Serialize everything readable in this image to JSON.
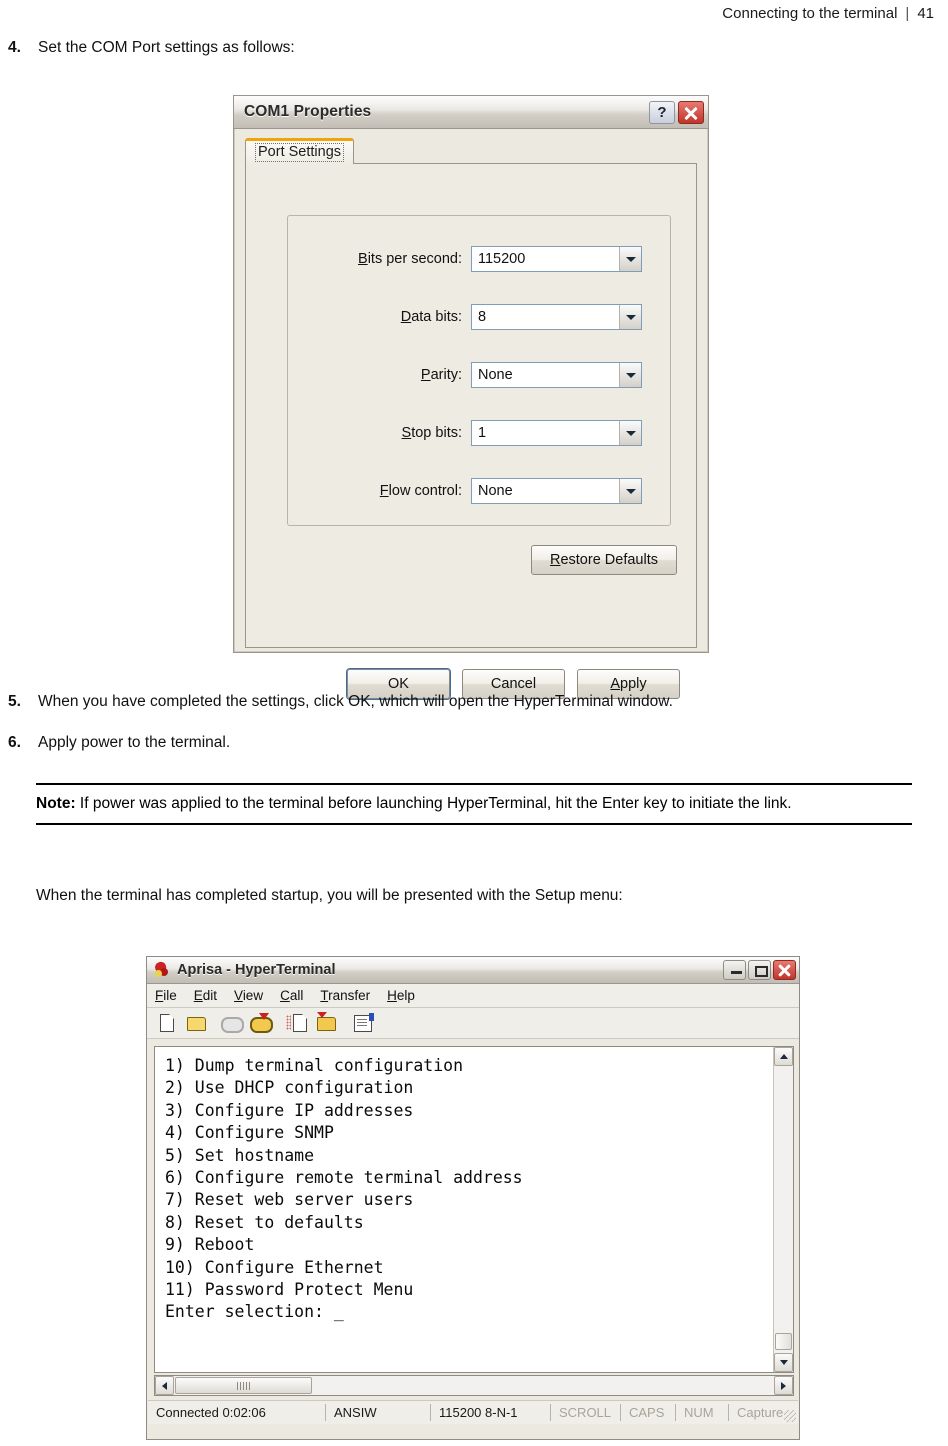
{
  "page_header": {
    "title": "Connecting to the terminal",
    "separator": "|",
    "page_number": "41"
  },
  "steps": [
    {
      "num": "4.",
      "text": "Set the COM Port settings as follows:"
    },
    {
      "num": "5.",
      "text": "When you have completed the settings, click OK, which will open the HyperTerminal window."
    },
    {
      "num": "6.",
      "text": "Apply power to the terminal."
    }
  ],
  "note": {
    "label": "Note:",
    "text": " If power was applied to the terminal before launching HyperTerminal, hit the Enter key to initiate the link."
  },
  "paragraph": "When the terminal has completed startup, you will be presented with the Setup menu:",
  "com_dialog": {
    "title": "COM1 Properties",
    "help_button": "?",
    "tab": "Port Settings",
    "fields": [
      {
        "label_pre": "B",
        "label_rest": "its per second:",
        "value": "115200"
      },
      {
        "label_pre": "D",
        "label_rest": "ata bits:",
        "value": "8"
      },
      {
        "label_pre": "P",
        "label_rest": "arity:",
        "value": "None"
      },
      {
        "label_pre": "S",
        "label_rest": "top bits:",
        "value": "1"
      },
      {
        "label_pre": "F",
        "label_rest": "low control:",
        "value": "None"
      }
    ],
    "restore_pre": "R",
    "restore_rest": "estore Defaults",
    "ok": "OK",
    "cancel": "Cancel",
    "apply_pre": "A",
    "apply_rest": "pply"
  },
  "hyperterminal": {
    "title": "Aprisa - HyperTerminal",
    "menus": [
      {
        "pre": "F",
        "rest": "ile"
      },
      {
        "pre": "E",
        "rest": "dit"
      },
      {
        "pre": "V",
        "rest": "iew"
      },
      {
        "pre": "C",
        "rest": "all"
      },
      {
        "pre": "T",
        "rest": "ransfer"
      },
      {
        "pre": "H",
        "rest": "elp"
      }
    ],
    "terminal_text": "1) Dump terminal configuration\n2) Use DHCP configuration\n3) Configure IP addresses\n4) Configure SNMP\n5) Set hostname\n6) Configure remote terminal address\n7) Reset web server users\n8) Reset to defaults\n9) Reboot\n10) Configure Ethernet\n11) Password Protect Menu\nEnter selection: _",
    "status": {
      "connected": "Connected 0:02:06",
      "emulation": "ANSIW",
      "line_settings": "115200 8-N-1",
      "scroll": "SCROLL",
      "caps": "CAPS",
      "num": "NUM",
      "capture": "Capture"
    }
  }
}
